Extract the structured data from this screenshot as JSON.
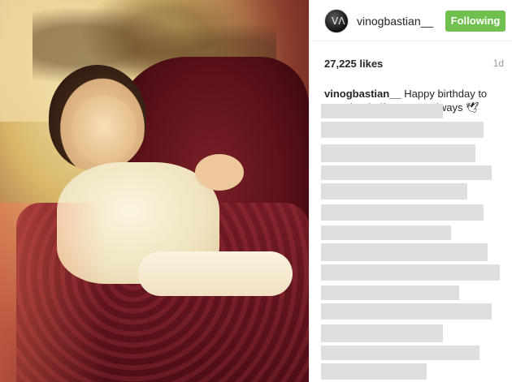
{
  "post": {
    "username": "vinogbastian__",
    "follow_label": "Following",
    "likes": "27,225 likes",
    "time_ago": "1d",
    "caption_user": "vinogbastian__",
    "caption_text": "Happy birthday to my other half.. Love U always 🕊"
  },
  "colors": {
    "follow_button": "#70c050",
    "pixelated_comments": "#dfdfdf"
  },
  "icons": {
    "avatar": "profile-avatar"
  }
}
